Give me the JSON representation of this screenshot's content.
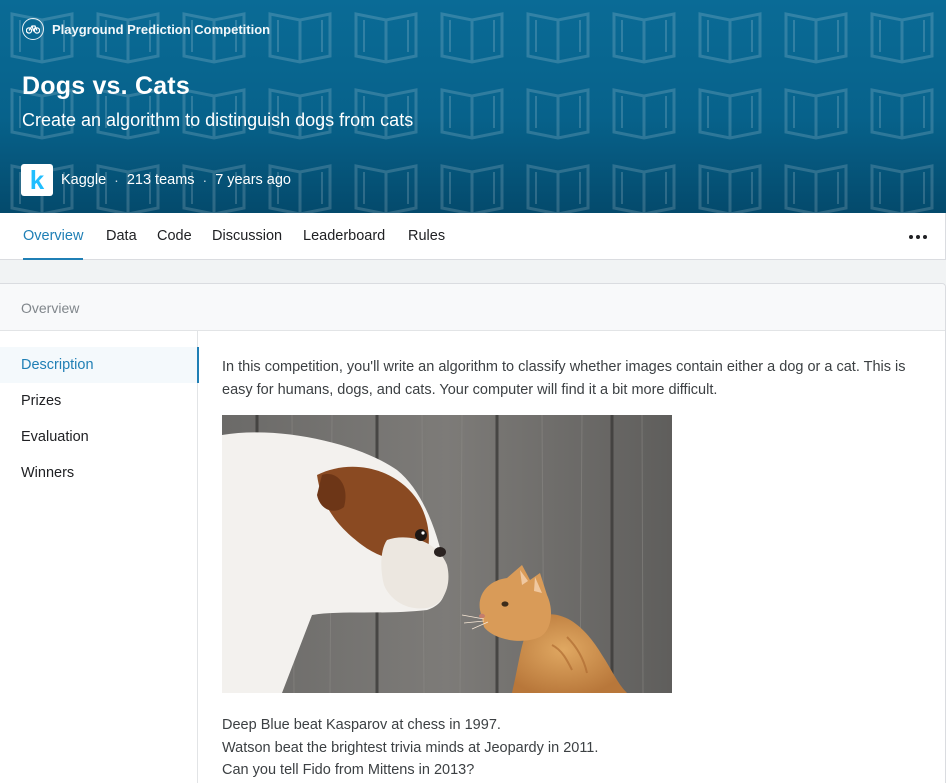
{
  "banner": {
    "type_label": "Playground Prediction Competition",
    "title": "Dogs vs. Cats",
    "subtitle": "Create an algorithm to distinguish dogs from cats",
    "host_logo_letter": "k",
    "host": "Kaggle",
    "teams": "213 teams",
    "age": "7 years ago",
    "separator": "·"
  },
  "tabs": [
    {
      "label": "Overview",
      "active": true
    },
    {
      "label": "Data"
    },
    {
      "label": "Code"
    },
    {
      "label": "Discussion"
    },
    {
      "label": "Leaderboard"
    },
    {
      "label": "Rules"
    }
  ],
  "card": {
    "header": "Overview",
    "sidebar": [
      {
        "label": "Description",
        "active": true
      },
      {
        "label": "Prizes"
      },
      {
        "label": "Evaluation"
      },
      {
        "label": "Winners"
      }
    ],
    "description": {
      "intro": "In this competition, you'll write an algorithm to classify whether images contain either a dog or a cat.  This is easy for humans, dogs, and cats. Your computer will find it a bit more difficult.",
      "lines": [
        "Deep Blue beat Kasparov at chess in 1997.",
        "Watson beat the brightest trivia minds at Jeopardy in 2011.",
        "Can you tell Fido from Mittens in 2013?"
      ]
    }
  },
  "icons": {
    "competition_type": "bicycle-icon",
    "more": "more-horizontal-icon"
  },
  "colors": {
    "banner": "#07628b",
    "accent": "#1f7fb5",
    "host_logo": "#20beff"
  }
}
